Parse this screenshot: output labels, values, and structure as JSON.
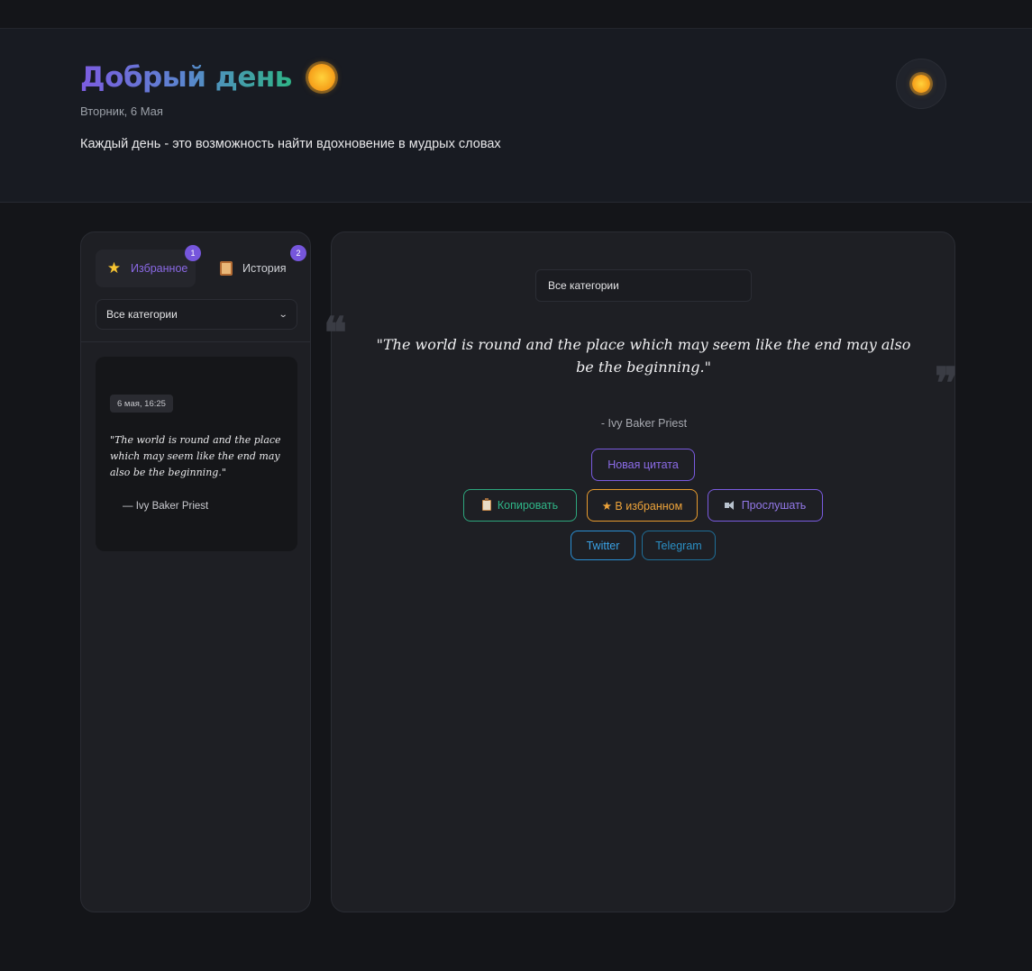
{
  "header": {
    "greeting": "Добрый день",
    "greeting_icon": "sun-icon",
    "date": "Вторник, 6 Мая",
    "motto": "Каждый день - это возможность найти вдохновение в мудрых словах",
    "theme_toggle_icon": "sun-icon"
  },
  "sidebar": {
    "tabs": [
      {
        "label": "Избранное",
        "icon": "star-icon",
        "badge": "1",
        "active": true
      },
      {
        "label": "История",
        "icon": "scroll-icon",
        "badge": "2",
        "active": false
      }
    ],
    "category_select": {
      "value": "Все категории"
    },
    "favorites": [
      {
        "date": "6 мая, 16:25",
        "quote": "\"The world is round and the place which may seem like the end may also be the beginning.\"",
        "author": "— Ivy Baker Priest"
      }
    ]
  },
  "main": {
    "category_select": {
      "value": "Все категории"
    },
    "quote_open_mark": "❝",
    "quote_close_mark": "❞",
    "quote": "\"The world is round and the place which may seem like the end may also be the beginning.\"",
    "author": "- Ivy Baker Priest",
    "buttons": {
      "new_quote": "Новая цитата",
      "copy": "Копировать",
      "favorite": "★ В избранном",
      "listen": "Прослушать",
      "twitter": "Twitter",
      "telegram": "Telegram"
    }
  },
  "colors": {
    "background": "#141519",
    "panel": "#1e1f24",
    "accent_purple": "#7a5be0",
    "accent_green": "#2fb688",
    "accent_orange": "#efa43a",
    "accent_blue": "#3aa2e6"
  }
}
